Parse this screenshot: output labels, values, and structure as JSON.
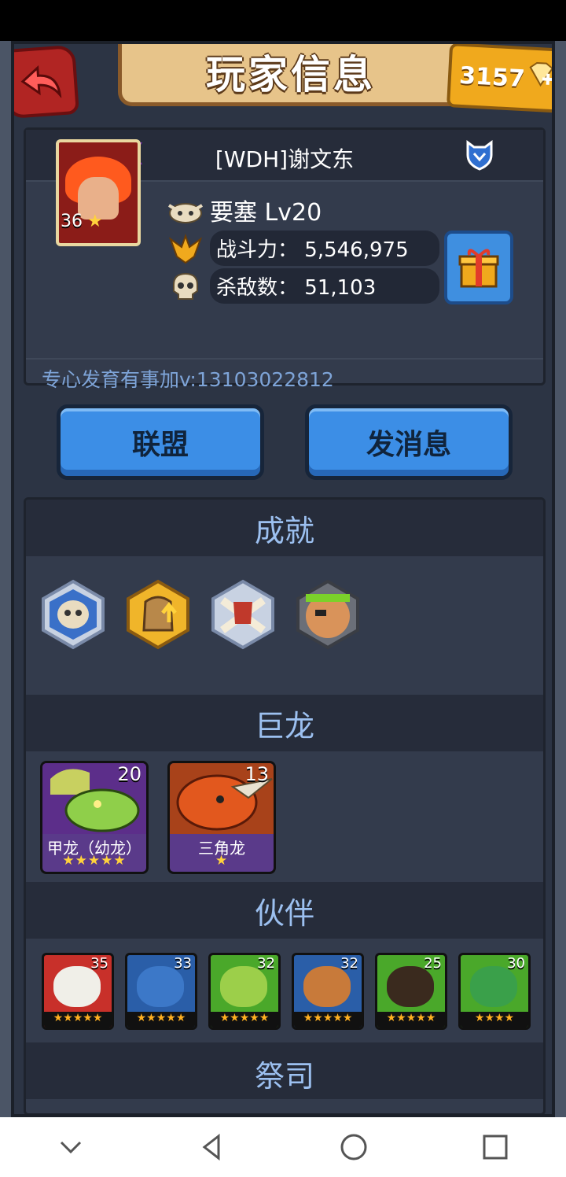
{
  "header": {
    "title": "玩家信息",
    "gems": "3157"
  },
  "player": {
    "name": "[WDH]谢文东",
    "ribbon_stars": "★★",
    "avatar_level": "36",
    "avatar_star": "★",
    "fortress": "要塞 Lv20",
    "power_label": "战斗力：",
    "power_value": "5,546,975",
    "kills_label": "杀敌数：",
    "kills_value": "51,103",
    "signature": "专心发育有事加v:13103022812"
  },
  "buttons": {
    "alliance": "联盟",
    "message": "发消息"
  },
  "sections": {
    "achievements": "成就",
    "dragons": "巨龙",
    "partners": "伙伴",
    "next_cut": "祭司"
  },
  "dragons": [
    {
      "name": "甲龙（幼龙）",
      "level": "20",
      "stars": "★★★★★"
    },
    {
      "name": "三角龙",
      "level": "13",
      "stars": "★"
    }
  ],
  "partners": [
    {
      "level": "35",
      "stars": "★★★★★",
      "color": "#f0efe8"
    },
    {
      "level": "33",
      "stars": "★★★★★",
      "color": "#3c78c8"
    },
    {
      "level": "32",
      "stars": "★★★★★",
      "color": "#9ccf4a"
    },
    {
      "level": "32",
      "stars": "★★★★★",
      "color": "#c87a3a"
    },
    {
      "level": "25",
      "stars": "★★★★★",
      "color": "#3a2a1e"
    },
    {
      "level": "30",
      "stars": "★★★★",
      "color": "#3aa04a"
    }
  ],
  "colors": {
    "panel": "#333b4c",
    "section_head": "#262c3a",
    "section_text": "#9cc0f0",
    "button_blue": "#3c8ee6"
  }
}
